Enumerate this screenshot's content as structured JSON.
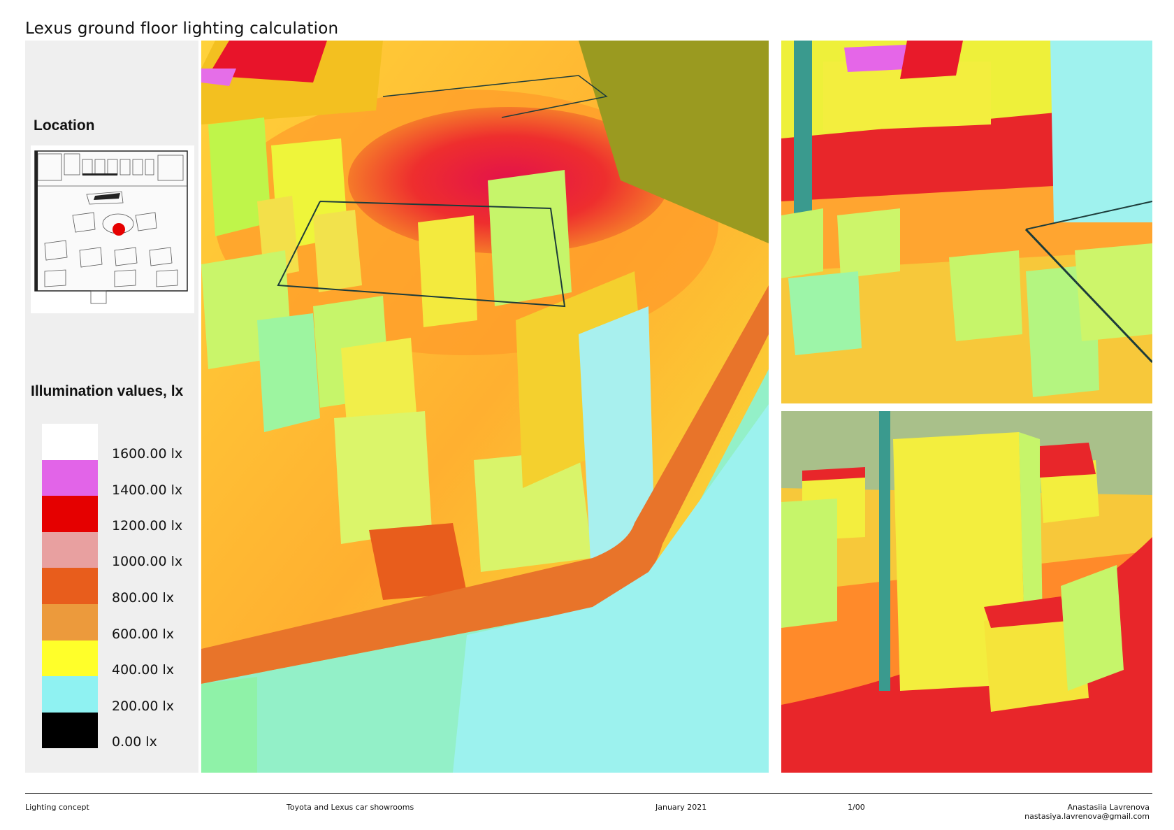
{
  "title": "Lexus ground floor lighting calculation",
  "location": {
    "heading": "Location"
  },
  "legend": {
    "heading": "Illumination values, lx",
    "items": [
      {
        "label": "1600.00 lx",
        "color": "#ffffff"
      },
      {
        "label": "1400.00 lx",
        "color": "#e264e8"
      },
      {
        "label": "1200.00 lx",
        "color": "#e50000"
      },
      {
        "label": "1000.00 lx",
        "color": "#e8a0a0"
      },
      {
        "label": "800.00 lx",
        "color": "#e85d1c"
      },
      {
        "label": "600.00 lx",
        "color": "#ec9a3c"
      },
      {
        "label": "400.00 lx",
        "color": "#ffff2a"
      },
      {
        "label": "200.00 lx",
        "color": "#8ff2f2"
      },
      {
        "label": "0.00 lx",
        "color": "#000000"
      }
    ]
  },
  "footer": {
    "left": "Lighting concept",
    "project": "Toyota and Lexus car showrooms",
    "date": "January 2021",
    "page": "1/00",
    "author": "Anastasiia Lavrenova",
    "email": "nastasiya.lavrenova@gmail.com"
  }
}
